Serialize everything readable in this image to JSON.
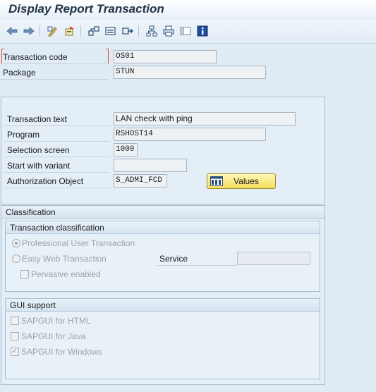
{
  "window": {
    "title": "Display Report Transaction"
  },
  "toolbar": {
    "icons": [
      "back-arrow-icon",
      "forward-arrow-icon",
      "display-change-icon",
      "other-object-icon",
      "where-used-icon",
      "transport-icon",
      "navigate-icon",
      "hierarchy-icon",
      "print-icon",
      "layout-icon",
      "info-icon"
    ]
  },
  "header_fields": {
    "tcode_label": "Transaction code",
    "tcode_value": "OS01",
    "package_label": "Package",
    "package_value": "STUN"
  },
  "attributes": {
    "transaction_text_label": "Transaction text",
    "transaction_text_value": "LAN check with ping",
    "program_label": "Program",
    "program_value": "RSHOST14",
    "selection_screen_label": "Selection screen",
    "selection_screen_value": "1000",
    "start_variant_label": "Start with variant",
    "start_variant_value": "",
    "auth_object_label": "Authorization Object",
    "auth_object_value": "S_ADMI_FCD",
    "values_button": "Values"
  },
  "classification": {
    "title": "Classification",
    "transaction_classification": {
      "title": "Transaction classification",
      "professional": {
        "label": "Professional User Transaction",
        "selected": true
      },
      "easy_web": {
        "label": "Easy Web Transaction",
        "selected": false
      },
      "service_label": "Service",
      "service_value": "",
      "pervasive": {
        "label": "Pervasive enabled",
        "checked": false
      }
    },
    "gui_support": {
      "title": "GUI support",
      "html": {
        "label": "SAPGUI for HTML",
        "checked": false
      },
      "java": {
        "label": "SAPGUI for Java",
        "checked": false
      },
      "windows": {
        "label": "SAPGUI for Windows",
        "checked": true
      }
    }
  },
  "colors": {
    "background": "#dfebf5",
    "values_button": "#f6de5e",
    "required_marker": "#e04a2a"
  }
}
